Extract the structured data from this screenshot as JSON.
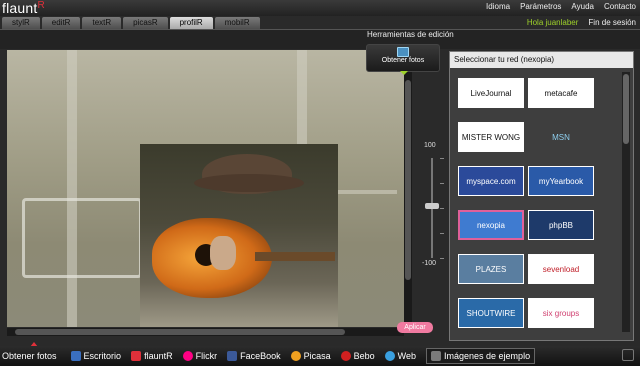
{
  "app": {
    "logo": "flaunt",
    "logo_r": "R"
  },
  "topmenu": [
    "Idioma",
    "Parámetros",
    "Ayuda",
    "Contacto"
  ],
  "user": {
    "hello": "Hola juanlaber",
    "logout": "Fin de sesión"
  },
  "tabs": [
    {
      "label": "stylR",
      "active": false
    },
    {
      "label": "editR",
      "active": false
    },
    {
      "label": "textR",
      "active": false
    },
    {
      "label": "picasR",
      "active": false
    },
    {
      "label": "profilR",
      "active": true
    },
    {
      "label": "mobilR",
      "active": false
    }
  ],
  "edit_title": "Herramientas de edición",
  "get_photos_button": "Obtener fotos",
  "slider": {
    "max_label": "100",
    "min_label": "-100"
  },
  "panel": {
    "title": "Seleccionar tu red (nexopia)",
    "networks": [
      "LiveJournal",
      "metacafe",
      "MISTER WONG",
      "MSN",
      "myspace.com",
      "myYearbook",
      "nexopia",
      "phpBB",
      "PLAZES",
      "sevenload",
      "SHOUTWIRE",
      "six groups"
    ],
    "selected": "nexopia"
  },
  "apply_button": "Aplicar",
  "taskbar": {
    "label": "Obtener fotos",
    "items": [
      {
        "label": "Escritorio",
        "icon": "desktop-icon",
        "color": "#3a6fc0"
      },
      {
        "label": "flauntR",
        "icon": "flauntr-icon",
        "color": "#e0303a"
      },
      {
        "label": "Flickr",
        "icon": "flickr-icon",
        "color": "#ff0084"
      },
      {
        "label": "FaceBook",
        "icon": "facebook-icon",
        "color": "#3b5998"
      },
      {
        "label": "Picasa",
        "icon": "picasa-icon",
        "color": "#f0a020"
      },
      {
        "label": "Bebo",
        "icon": "bebo-icon",
        "color": "#d02020"
      },
      {
        "label": "Web",
        "icon": "web-icon",
        "color": "#3aa0e0"
      },
      {
        "label": "Imágenes de ejemplo",
        "icon": "sample-images-icon",
        "color": "#7a7a7a",
        "active": true
      }
    ]
  }
}
